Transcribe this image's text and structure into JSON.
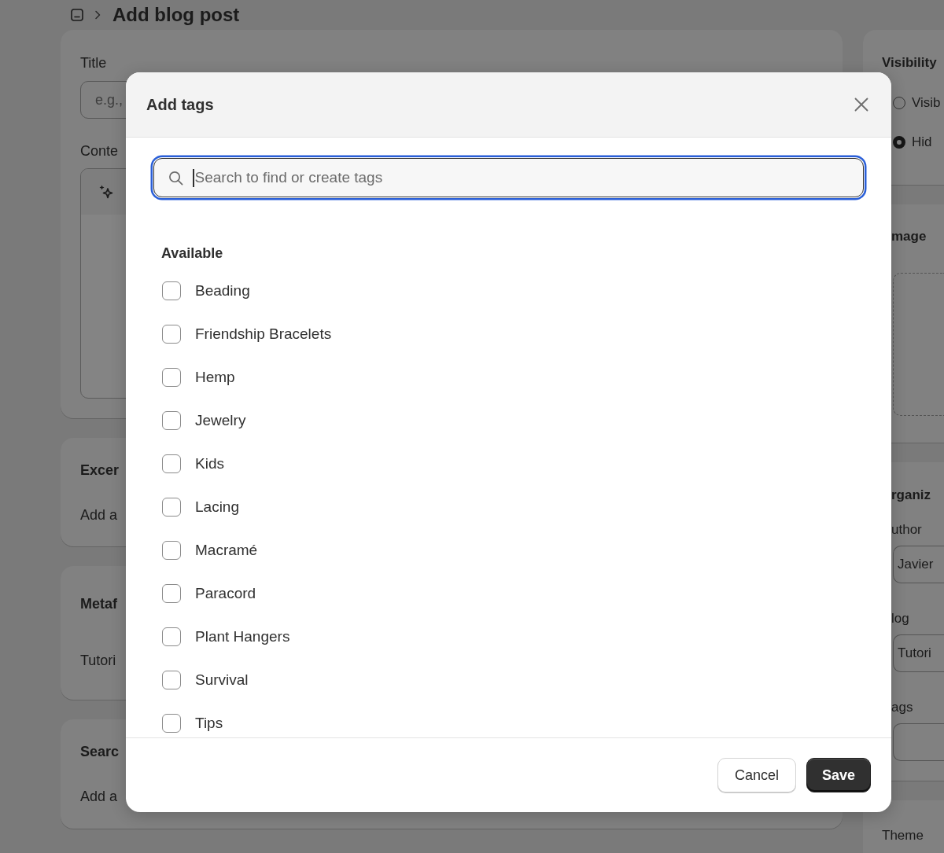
{
  "page_title": "Add blog post",
  "main_card": {
    "title_field": {
      "label": "Title",
      "placeholder": "e.g.,"
    },
    "content_field": {
      "label": "Conte"
    }
  },
  "left_cards": [
    {
      "heading": "Excer",
      "text": "Add a"
    },
    {
      "heading": "Metaf",
      "text": "Tutori"
    },
    {
      "heading": "Searc",
      "text": "Add a"
    }
  ],
  "right_cards": [
    {
      "kind": "radios",
      "heading": "Visibility",
      "options": [
        {
          "label": "Visib",
          "selected": false
        },
        {
          "label": "Hid",
          "selected": true
        }
      ]
    },
    {
      "kind": "upload",
      "heading": "mage"
    },
    {
      "kind": "fields",
      "heading": "rganiz",
      "fields": [
        {
          "label": "uthor",
          "value": "Javier"
        },
        {
          "label": "log",
          "value": "Tutori"
        },
        {
          "label": "ags"
        }
      ]
    },
    {
      "kind": "plain",
      "heading": "Theme"
    }
  ],
  "modal": {
    "title": "Add tags",
    "search": {
      "placeholder": "Search to find or create tags"
    },
    "section_title": "Available",
    "tags": [
      {
        "label": "Beading",
        "checked": false
      },
      {
        "label": "Friendship Bracelets",
        "checked": false
      },
      {
        "label": "Hemp",
        "checked": false
      },
      {
        "label": "Jewelry",
        "checked": false
      },
      {
        "label": "Kids",
        "checked": false
      },
      {
        "label": "Lacing",
        "checked": false
      },
      {
        "label": "Macramé",
        "checked": false
      },
      {
        "label": "Paracord",
        "checked": false
      },
      {
        "label": "Plant Hangers",
        "checked": false
      },
      {
        "label": "Survival",
        "checked": false
      },
      {
        "label": "Tips",
        "checked": false
      }
    ],
    "buttons": [
      {
        "kind": "secondary",
        "label": "Cancel"
      },
      {
        "kind": "primary",
        "label": "Save"
      }
    ]
  }
}
